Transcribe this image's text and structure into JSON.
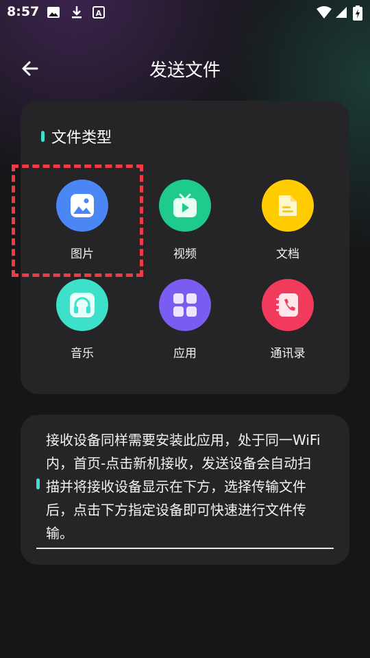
{
  "status_bar": {
    "time": "8:57",
    "left_icons": [
      "image-icon",
      "download-icon",
      "text-icon"
    ],
    "right_icons": [
      "wifi-icon",
      "signal-icon",
      "battery-charging-icon"
    ]
  },
  "header": {
    "back_icon": "arrow-left-icon",
    "title": "发送文件"
  },
  "file_types_card": {
    "title": "文件类型",
    "items": [
      {
        "label": "图片",
        "icon": "image-icon",
        "color": "#4a87f5"
      },
      {
        "label": "视频",
        "icon": "tv-icon",
        "color": "#1fcb8c"
      },
      {
        "label": "文档",
        "icon": "document-icon",
        "color": "#ffcc00"
      },
      {
        "label": "音乐",
        "icon": "headphones-icon",
        "color": "#3de0c8"
      },
      {
        "label": "应用",
        "icon": "apps-grid-icon",
        "color": "#7a5cf0"
      },
      {
        "label": "通讯录",
        "icon": "contacts-phone-icon",
        "color": "#f23a5c"
      }
    ],
    "highlight_color": "#ef3c44"
  },
  "info_card": {
    "lines": [
      "接收设备同样需要安装此应用，处于同一WiFi",
      "内，首页-点击新机接收，发送设备会自动扫",
      "描并将接收设备显示在下方，选择传输文件",
      "后，点击下方指定设备即可快速进行文件传",
      "输。"
    ]
  },
  "colors": {
    "background": "#161618",
    "card": "#252528",
    "accent": "#3fe0d0"
  }
}
